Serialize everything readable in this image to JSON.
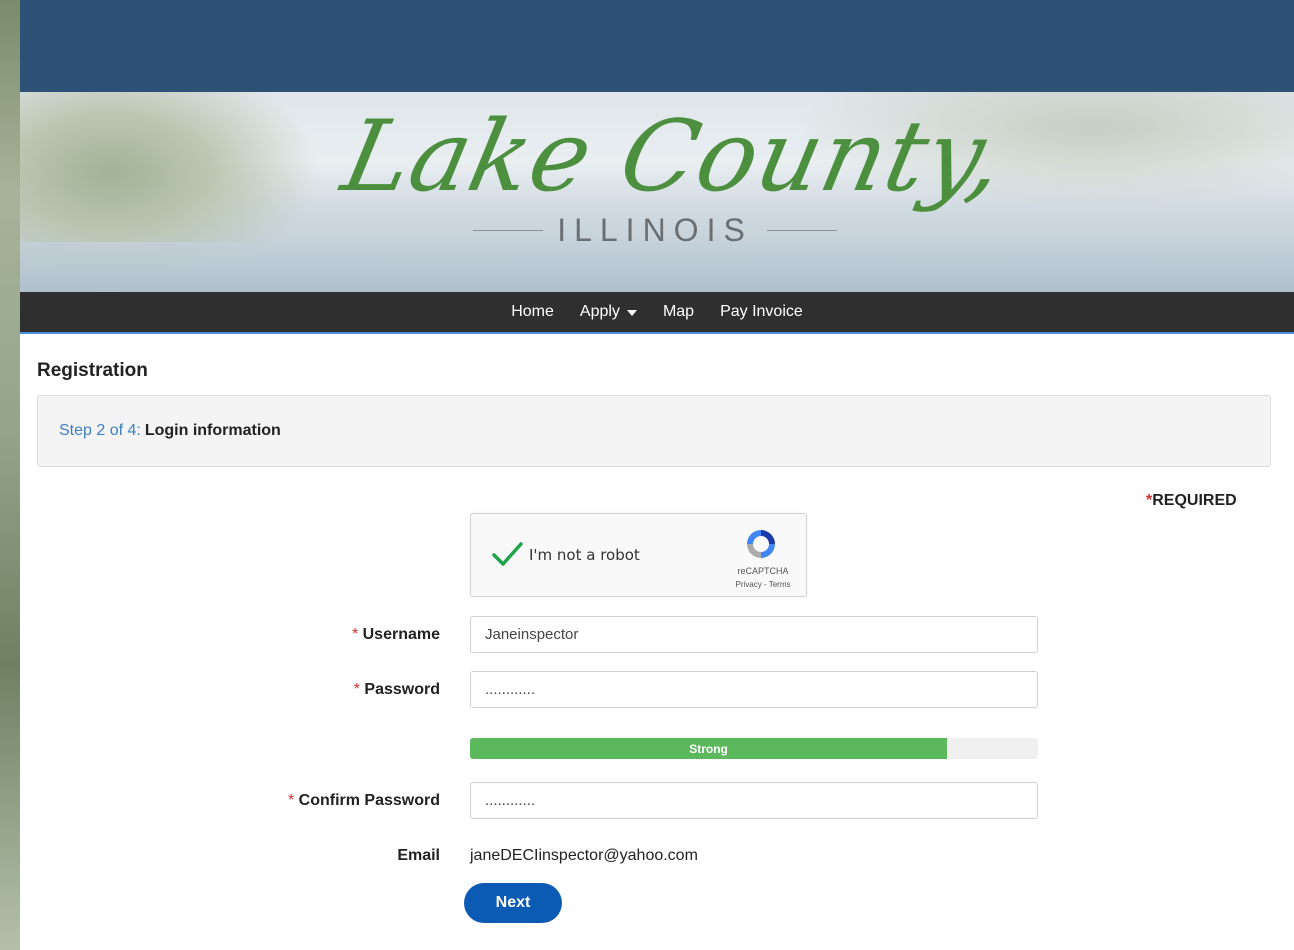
{
  "header": {
    "logo_script": "Lake County,",
    "logo_sub": "ILLINOIS"
  },
  "nav": {
    "items": [
      {
        "label": "Home"
      },
      {
        "label": "Apply"
      },
      {
        "label": "Map"
      },
      {
        "label": "Pay Invoice"
      }
    ]
  },
  "page": {
    "title": "Registration",
    "step_label": "Step 2 of 4:",
    "step_text": "Login information",
    "required_label": "REQUIRED"
  },
  "captcha": {
    "label": "I'm not a robot",
    "brand": "reCAPTCHA",
    "links": "Privacy - Terms",
    "checked": true
  },
  "form": {
    "username_label": "Username",
    "username_value": "Janeinspector",
    "password_label": "Password",
    "password_value": "............",
    "strength_label": "Strong",
    "strength_percent": 84,
    "confirm_label": "Confirm Password",
    "confirm_value": "............",
    "email_label": "Email",
    "email_value": "janeDECIinspector@yahoo.com"
  },
  "actions": {
    "next_label": "Next"
  },
  "colors": {
    "topbar": "#2d5275",
    "navbar": "#2f2f2f",
    "accent": "#0b5ab4",
    "strength": "#5cb85c",
    "logo_green": "#4c8f3f",
    "required_star": "#d9302f"
  }
}
